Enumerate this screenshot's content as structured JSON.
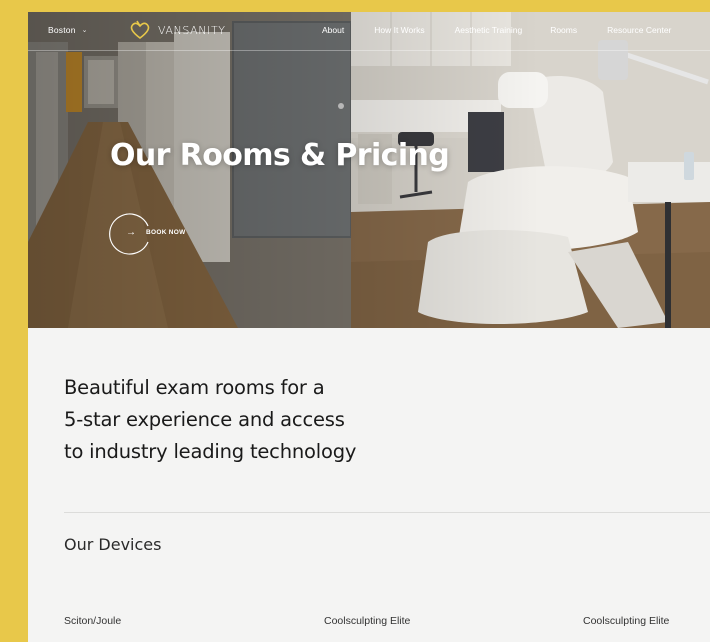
{
  "nav": {
    "city": "Boston",
    "brand": "VANSANITY",
    "links": [
      "About",
      "How It Works",
      "Aesthetic Training",
      "Rooms",
      "Resource Center"
    ]
  },
  "hero": {
    "title": "Our Rooms & Pricing",
    "book_now": "BOOK NOW"
  },
  "intro": {
    "lines": [
      "Beautiful exam rooms for a",
      "5-star experience and access",
      "to industry leading technology"
    ]
  },
  "devices": {
    "heading": "Our Devices",
    "items": [
      "Sciton/Joule",
      "Coolsculpting Elite",
      "Coolsculpting Elite"
    ]
  },
  "colors": {
    "page_border": "#e8c84a",
    "content_bg": "#f4f4f3",
    "text_dark": "#1a1a1a"
  },
  "icons": {
    "city_dropdown": "chevron-down-icon",
    "logo": "heart-logo-icon",
    "book_now": "arrow-right-icon"
  }
}
